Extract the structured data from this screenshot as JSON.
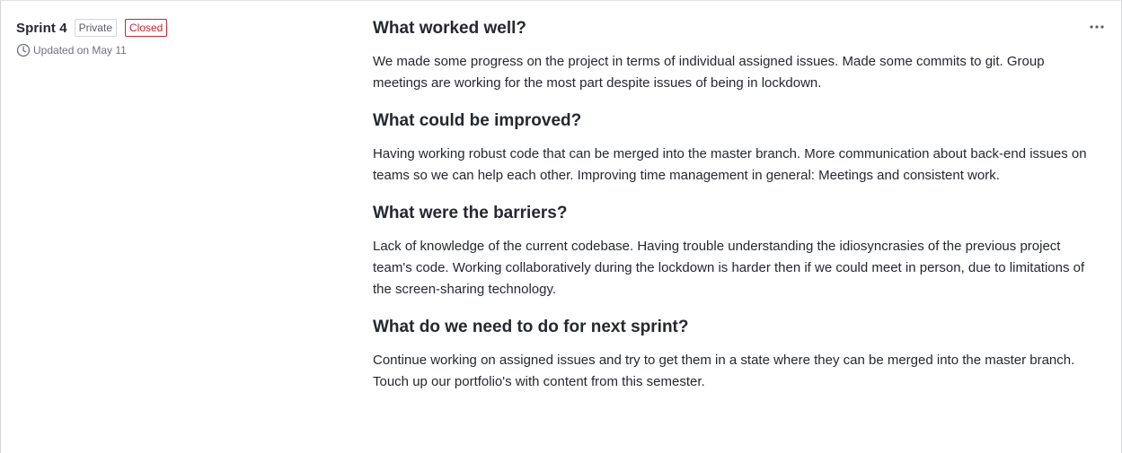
{
  "sidebar": {
    "title": "Sprint 4",
    "badges": {
      "private": "Private",
      "closed": "Closed"
    },
    "updated": "Updated on May 11",
    "icon": "clock-icon"
  },
  "actions": {
    "more_icon": "kebab-horizontal-icon"
  },
  "sections": [
    {
      "heading": "What worked well?",
      "body": "We made some progress on the project in terms of individual assigned issues. Made some commits to git. Group meetings are working for the most part despite issues of being in lockdown."
    },
    {
      "heading": "What could be improved?",
      "body": "Having working robust code that can be merged into the master branch. More communication about back-end issues on teams so we can help each other. Improving time management in general: Meetings and consistent work."
    },
    {
      "heading": "What were the barriers?",
      "body": "Lack of knowledge of the current codebase. Having trouble understanding the idiosyncrasies of the previous project team's code. Working collaboratively during the lockdown is harder then if we could meet in person, due to limitations of the screen-sharing technology."
    },
    {
      "heading": "What do we need to do for next sprint?",
      "body": "Continue working on assigned issues and try to get them in a state where they can be merged into the master branch. Touch up our portfolio's with content from this semester."
    }
  ],
  "colors": {
    "text": "#24292e",
    "muted": "#586069",
    "closed": "#cb2431",
    "border": "#d1d5da"
  }
}
